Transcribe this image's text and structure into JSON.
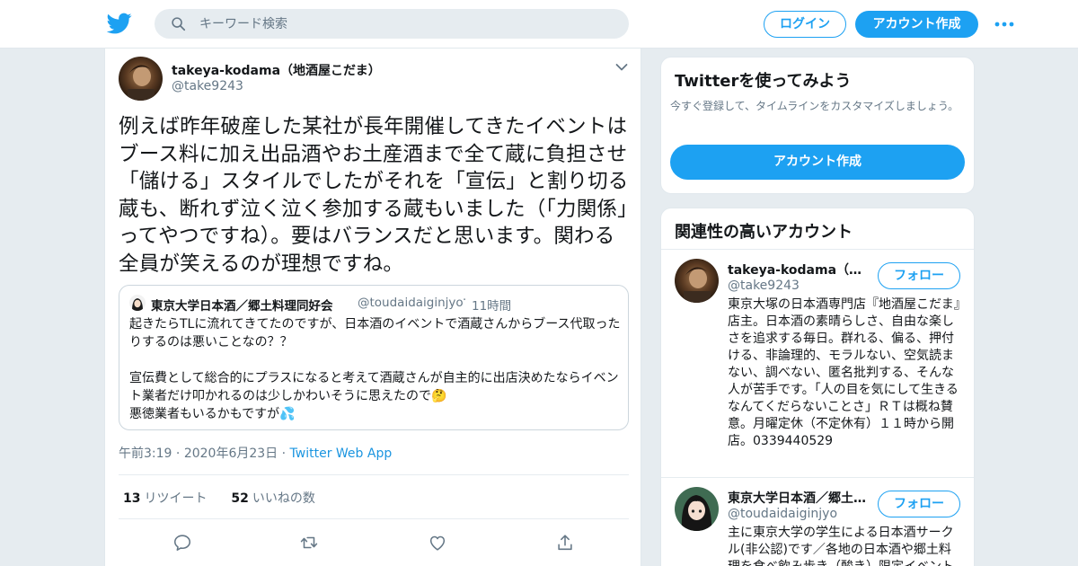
{
  "header": {
    "search_placeholder": "キーワード検索",
    "login_label": "ログイン",
    "signup_label": "アカウント作成"
  },
  "tweet": {
    "author_name": "takeya-kodama（地酒屋こだま）",
    "author_handle": "@take9243",
    "text": "例えば昨年破産した某社が長年開催してきたイベントはブース料に加え出品酒やお土産酒まで全て蔵に負担させ「儲ける」スタイルでしたがそれを「宣伝」と割り切る蔵も、断れず泣く泣く参加する蔵もいました（「力関係」ってやつですね）。要はバランスだと思います。関わる全員が笑えるのが理想ですね。",
    "quote": {
      "author_name": "東京大学日本酒／郷土料理同好会",
      "author_handle": "@toudaidaiginjyo",
      "time": "11時間",
      "text": "起きたらTLに流れてきてたのですが、日本酒のイベントで酒蔵さんからブース代取ったりするのは悪いことなの？？\n\n宣伝費として総合的にプラスになると考えて酒蔵さんが自主的に出店決めたならイベント業者だけ叩かれるのは少しかわいそうに思えたので🤔\n悪徳業者もいるかもですが💦"
    },
    "time": "午前3:19",
    "date": "2020年6月23日",
    "source": "Twitter Web App",
    "retweets_count": "13",
    "retweets_label": "リツイート",
    "likes_count": "52",
    "likes_label": "いいねの数"
  },
  "sidebar": {
    "try_card": {
      "title": "Twitterを使ってみよう",
      "desc": "今すぐ登録して、タイムラインをカスタマイズしましょう。",
      "cta": "アカウント作成"
    },
    "related": {
      "title": "関連性の高いアカウント",
      "accounts": [
        {
          "name": "takeya-kodama（地酒屋こだま）",
          "handle": "@take9243",
          "follow_label": "フォロー",
          "bio": "東京大塚の日本酒専門店『地酒屋こだま』店主。日本酒の素晴らしさ、自由な楽しさを追求する毎日。群れる、偏る、押付ける、非論理的、モラルない、空気読まない、調べない、匿名批判する、そんな人が苦手です。「人の目を気にして生きるなんてくだらないことさ」ＲＴは概ね賛意。月曜定休（不定休有）１１時から開店。0339440529"
        },
        {
          "name": "東京大学日本酒／郷土料理同好会",
          "handle": "@toudaidaiginjyo",
          "follow_label": "フォロー",
          "bio": "主に東京大学の学生による日本酒サークル(非公認)です／各地の日本酒や郷土料理を食べ飲み歩き（酸き）限定イベントも開催しています"
        }
      ]
    }
  },
  "colors": {
    "brand": "#1da1f2",
    "link": "#1b95e0",
    "muted": "#657786",
    "background": "#e6ecf0"
  }
}
